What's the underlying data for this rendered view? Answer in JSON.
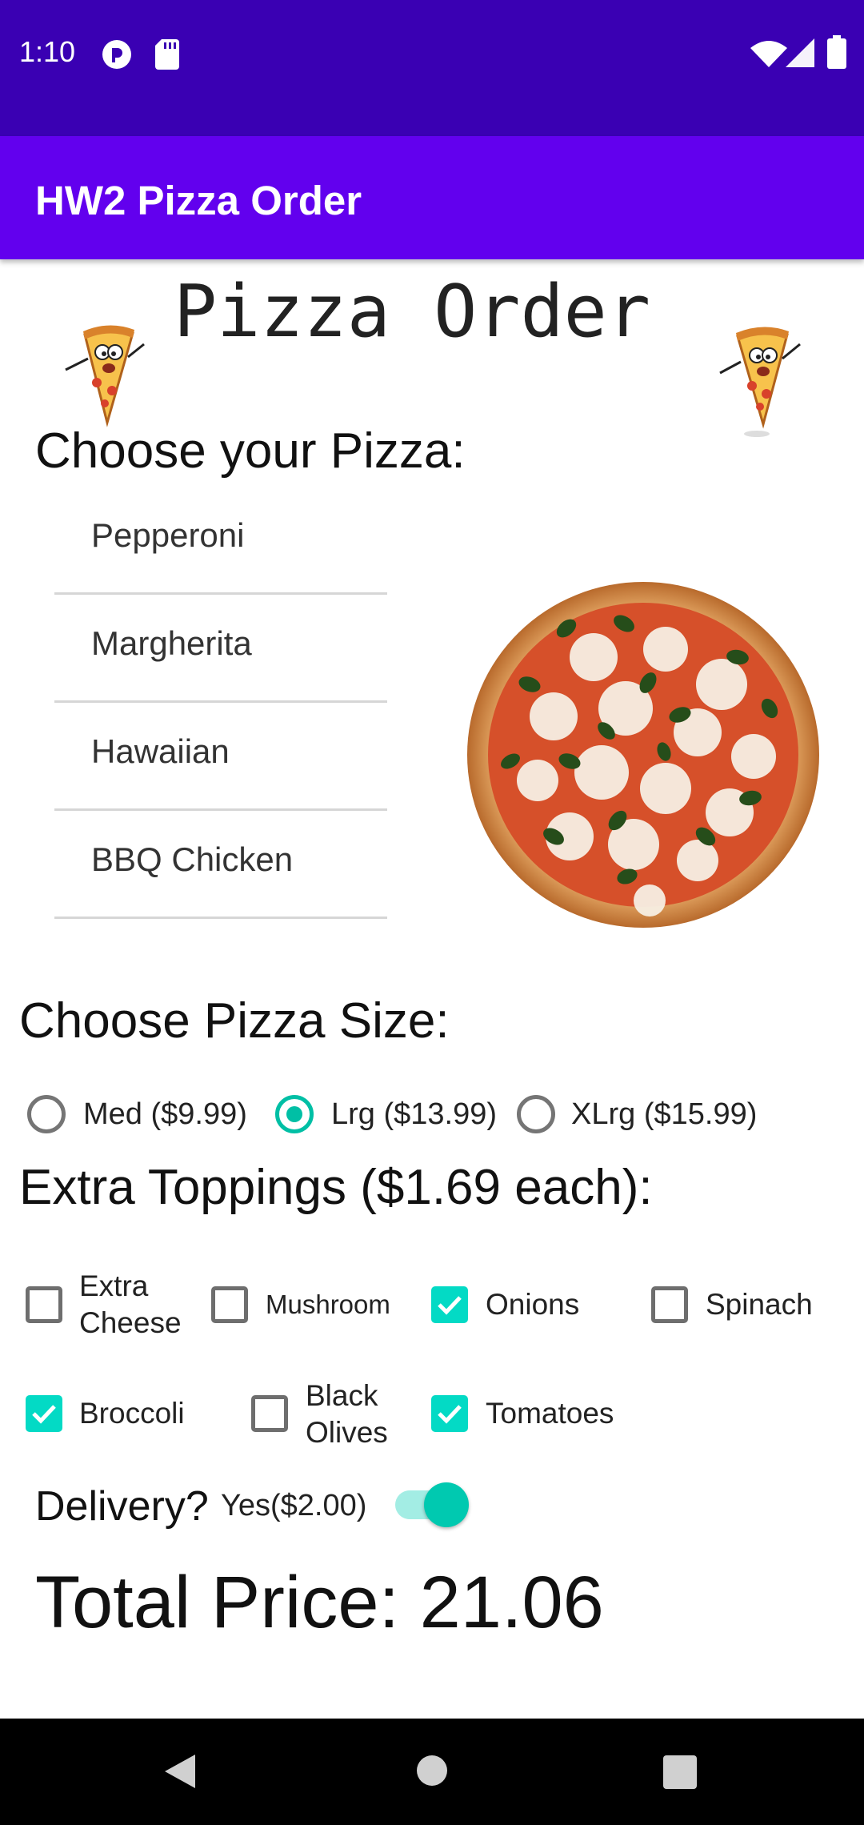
{
  "status_bar": {
    "time": "1:10",
    "left_icons": [
      "pocket-casts-icon",
      "sd-card-icon"
    ],
    "right_icons": [
      "wifi-icon",
      "signal-icon",
      "battery-icon"
    ]
  },
  "app_bar": {
    "title": "HW2 Pizza Order",
    "color": "#6200ee"
  },
  "heading": "Pizza Order",
  "pizza_section": {
    "title": "Choose your Pizza:",
    "items": [
      "Pepperoni",
      "Margherita",
      "Hawaiian",
      "BBQ Chicken"
    ]
  },
  "size_section": {
    "title": "Choose Pizza Size:",
    "options": [
      "Med ($9.99)",
      "Lrg ($13.99)",
      "XLrg ($15.99)"
    ],
    "selected": "Lrg ($13.99)"
  },
  "toppings_section": {
    "title": "Extra Toppings ($1.69 each):",
    "items": [
      {
        "label_1": "Extra",
        "label_2": "Cheese",
        "checked": false
      },
      {
        "label_1": "Mushroom",
        "checked": false
      },
      {
        "label_1": "Onions",
        "checked": true
      },
      {
        "label_1": "Spinach",
        "checked": false
      },
      {
        "label_1": "Broccoli",
        "checked": true
      },
      {
        "label_1": "Black",
        "label_2": "Olives",
        "checked": false
      },
      {
        "label_1": "Tomatoes",
        "checked": true
      }
    ]
  },
  "delivery": {
    "label": "Delivery?",
    "option": "Yes($2.00)",
    "enabled": true
  },
  "total": {
    "text": "Total Price: 21.06"
  },
  "colors": {
    "status_bar": "#3a00b3",
    "app_bar": "#6200ee",
    "accent": "#03dac5"
  },
  "nav_bar": {
    "icons": [
      "back-icon",
      "home-icon",
      "recents-icon"
    ]
  }
}
